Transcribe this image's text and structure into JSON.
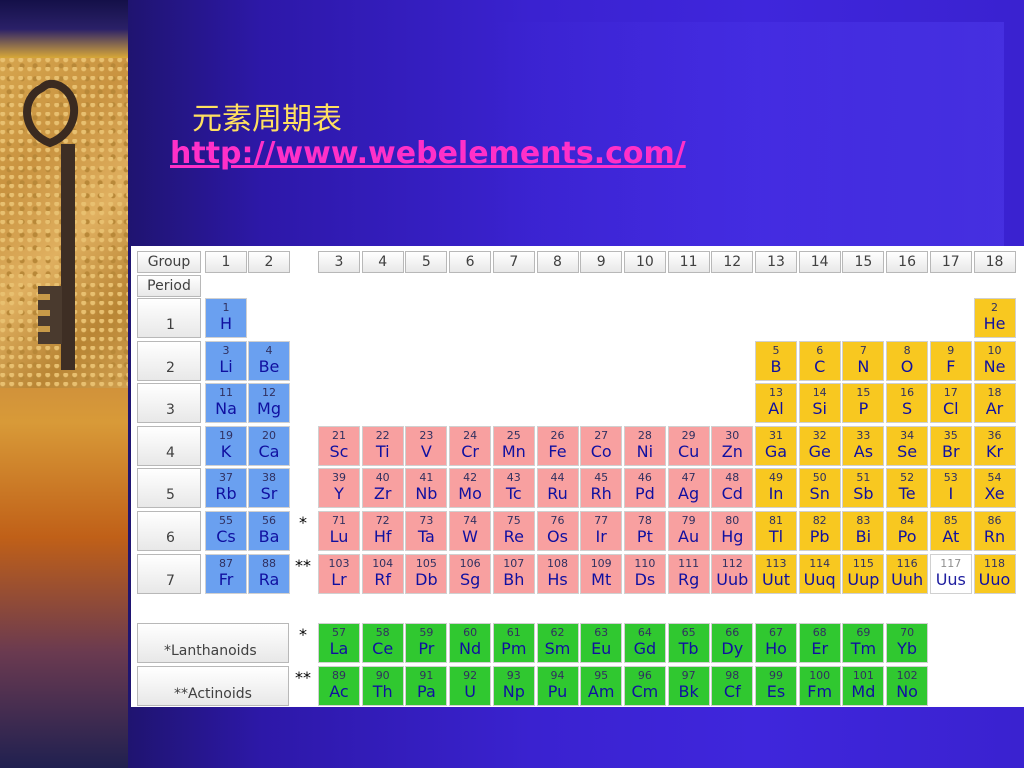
{
  "slide": {
    "title": "元素周期表",
    "link": "http://www.webelements.com/"
  },
  "table": {
    "group_label": "Group",
    "period_label": "Period",
    "groups": [
      "1",
      "2",
      "3",
      "4",
      "5",
      "6",
      "7",
      "8",
      "9",
      "10",
      "11",
      "12",
      "13",
      "14",
      "15",
      "16",
      "17",
      "18"
    ],
    "periods": [
      "1",
      "2",
      "3",
      "4",
      "5",
      "6",
      "7"
    ],
    "lanthanoids_label": "*Lanthanoids",
    "actinoids_label": "**Actinoids",
    "lanthanoid_marker": "*",
    "actinoid_marker": "**",
    "elements": [
      {
        "n": "1",
        "s": "H",
        "g": 1,
        "p": 1,
        "b": "s"
      },
      {
        "n": "2",
        "s": "He",
        "g": 18,
        "p": 1,
        "b": "p"
      },
      {
        "n": "3",
        "s": "Li",
        "g": 1,
        "p": 2,
        "b": "s"
      },
      {
        "n": "4",
        "s": "Be",
        "g": 2,
        "p": 2,
        "b": "s"
      },
      {
        "n": "5",
        "s": "B",
        "g": 13,
        "p": 2,
        "b": "p"
      },
      {
        "n": "6",
        "s": "C",
        "g": 14,
        "p": 2,
        "b": "p"
      },
      {
        "n": "7",
        "s": "N",
        "g": 15,
        "p": 2,
        "b": "p"
      },
      {
        "n": "8",
        "s": "O",
        "g": 16,
        "p": 2,
        "b": "p"
      },
      {
        "n": "9",
        "s": "F",
        "g": 17,
        "p": 2,
        "b": "p"
      },
      {
        "n": "10",
        "s": "Ne",
        "g": 18,
        "p": 2,
        "b": "p"
      },
      {
        "n": "11",
        "s": "Na",
        "g": 1,
        "p": 3,
        "b": "s"
      },
      {
        "n": "12",
        "s": "Mg",
        "g": 2,
        "p": 3,
        "b": "s"
      },
      {
        "n": "13",
        "s": "Al",
        "g": 13,
        "p": 3,
        "b": "p"
      },
      {
        "n": "14",
        "s": "Si",
        "g": 14,
        "p": 3,
        "b": "p"
      },
      {
        "n": "15",
        "s": "P",
        "g": 15,
        "p": 3,
        "b": "p"
      },
      {
        "n": "16",
        "s": "S",
        "g": 16,
        "p": 3,
        "b": "p"
      },
      {
        "n": "17",
        "s": "Cl",
        "g": 17,
        "p": 3,
        "b": "p"
      },
      {
        "n": "18",
        "s": "Ar",
        "g": 18,
        "p": 3,
        "b": "p"
      },
      {
        "n": "19",
        "s": "K",
        "g": 1,
        "p": 4,
        "b": "s"
      },
      {
        "n": "20",
        "s": "Ca",
        "g": 2,
        "p": 4,
        "b": "s"
      },
      {
        "n": "21",
        "s": "Sc",
        "g": 3,
        "p": 4,
        "b": "d"
      },
      {
        "n": "22",
        "s": "Ti",
        "g": 4,
        "p": 4,
        "b": "d"
      },
      {
        "n": "23",
        "s": "V",
        "g": 5,
        "p": 4,
        "b": "d"
      },
      {
        "n": "24",
        "s": "Cr",
        "g": 6,
        "p": 4,
        "b": "d"
      },
      {
        "n": "25",
        "s": "Mn",
        "g": 7,
        "p": 4,
        "b": "d"
      },
      {
        "n": "26",
        "s": "Fe",
        "g": 8,
        "p": 4,
        "b": "d"
      },
      {
        "n": "27",
        "s": "Co",
        "g": 9,
        "p": 4,
        "b": "d"
      },
      {
        "n": "28",
        "s": "Ni",
        "g": 10,
        "p": 4,
        "b": "d"
      },
      {
        "n": "29",
        "s": "Cu",
        "g": 11,
        "p": 4,
        "b": "d"
      },
      {
        "n": "30",
        "s": "Zn",
        "g": 12,
        "p": 4,
        "b": "d"
      },
      {
        "n": "31",
        "s": "Ga",
        "g": 13,
        "p": 4,
        "b": "p"
      },
      {
        "n": "32",
        "s": "Ge",
        "g": 14,
        "p": 4,
        "b": "p"
      },
      {
        "n": "33",
        "s": "As",
        "g": 15,
        "p": 4,
        "b": "p"
      },
      {
        "n": "34",
        "s": "Se",
        "g": 16,
        "p": 4,
        "b": "p"
      },
      {
        "n": "35",
        "s": "Br",
        "g": 17,
        "p": 4,
        "b": "p"
      },
      {
        "n": "36",
        "s": "Kr",
        "g": 18,
        "p": 4,
        "b": "p"
      },
      {
        "n": "37",
        "s": "Rb",
        "g": 1,
        "p": 5,
        "b": "s"
      },
      {
        "n": "38",
        "s": "Sr",
        "g": 2,
        "p": 5,
        "b": "s"
      },
      {
        "n": "39",
        "s": "Y",
        "g": 3,
        "p": 5,
        "b": "d"
      },
      {
        "n": "40",
        "s": "Zr",
        "g": 4,
        "p": 5,
        "b": "d"
      },
      {
        "n": "41",
        "s": "Nb",
        "g": 5,
        "p": 5,
        "b": "d"
      },
      {
        "n": "42",
        "s": "Mo",
        "g": 6,
        "p": 5,
        "b": "d"
      },
      {
        "n": "43",
        "s": "Tc",
        "g": 7,
        "p": 5,
        "b": "d"
      },
      {
        "n": "44",
        "s": "Ru",
        "g": 8,
        "p": 5,
        "b": "d"
      },
      {
        "n": "45",
        "s": "Rh",
        "g": 9,
        "p": 5,
        "b": "d"
      },
      {
        "n": "46",
        "s": "Pd",
        "g": 10,
        "p": 5,
        "b": "d"
      },
      {
        "n": "47",
        "s": "Ag",
        "g": 11,
        "p": 5,
        "b": "d"
      },
      {
        "n": "48",
        "s": "Cd",
        "g": 12,
        "p": 5,
        "b": "d"
      },
      {
        "n": "49",
        "s": "In",
        "g": 13,
        "p": 5,
        "b": "p"
      },
      {
        "n": "50",
        "s": "Sn",
        "g": 14,
        "p": 5,
        "b": "p"
      },
      {
        "n": "51",
        "s": "Sb",
        "g": 15,
        "p": 5,
        "b": "p"
      },
      {
        "n": "52",
        "s": "Te",
        "g": 16,
        "p": 5,
        "b": "p"
      },
      {
        "n": "53",
        "s": "I",
        "g": 17,
        "p": 5,
        "b": "p"
      },
      {
        "n": "54",
        "s": "Xe",
        "g": 18,
        "p": 5,
        "b": "p"
      },
      {
        "n": "55",
        "s": "Cs",
        "g": 1,
        "p": 6,
        "b": "s"
      },
      {
        "n": "56",
        "s": "Ba",
        "g": 2,
        "p": 6,
        "b": "s"
      },
      {
        "n": "71",
        "s": "Lu",
        "g": 3,
        "p": 6,
        "b": "d"
      },
      {
        "n": "72",
        "s": "Hf",
        "g": 4,
        "p": 6,
        "b": "d"
      },
      {
        "n": "73",
        "s": "Ta",
        "g": 5,
        "p": 6,
        "b": "d"
      },
      {
        "n": "74",
        "s": "W",
        "g": 6,
        "p": 6,
        "b": "d"
      },
      {
        "n": "75",
        "s": "Re",
        "g": 7,
        "p": 6,
        "b": "d"
      },
      {
        "n": "76",
        "s": "Os",
        "g": 8,
        "p": 6,
        "b": "d"
      },
      {
        "n": "77",
        "s": "Ir",
        "g": 9,
        "p": 6,
        "b": "d"
      },
      {
        "n": "78",
        "s": "Pt",
        "g": 10,
        "p": 6,
        "b": "d"
      },
      {
        "n": "79",
        "s": "Au",
        "g": 11,
        "p": 6,
        "b": "d"
      },
      {
        "n": "80",
        "s": "Hg",
        "g": 12,
        "p": 6,
        "b": "d"
      },
      {
        "n": "81",
        "s": "Tl",
        "g": 13,
        "p": 6,
        "b": "p"
      },
      {
        "n": "82",
        "s": "Pb",
        "g": 14,
        "p": 6,
        "b": "p"
      },
      {
        "n": "83",
        "s": "Bi",
        "g": 15,
        "p": 6,
        "b": "p"
      },
      {
        "n": "84",
        "s": "Po",
        "g": 16,
        "p": 6,
        "b": "p"
      },
      {
        "n": "85",
        "s": "At",
        "g": 17,
        "p": 6,
        "b": "p"
      },
      {
        "n": "86",
        "s": "Rn",
        "g": 18,
        "p": 6,
        "b": "p"
      },
      {
        "n": "87",
        "s": "Fr",
        "g": 1,
        "p": 7,
        "b": "s"
      },
      {
        "n": "88",
        "s": "Ra",
        "g": 2,
        "p": 7,
        "b": "s"
      },
      {
        "n": "103",
        "s": "Lr",
        "g": 3,
        "p": 7,
        "b": "d"
      },
      {
        "n": "104",
        "s": "Rf",
        "g": 4,
        "p": 7,
        "b": "d"
      },
      {
        "n": "105",
        "s": "Db",
        "g": 5,
        "p": 7,
        "b": "d"
      },
      {
        "n": "106",
        "s": "Sg",
        "g": 6,
        "p": 7,
        "b": "d"
      },
      {
        "n": "107",
        "s": "Bh",
        "g": 7,
        "p": 7,
        "b": "d"
      },
      {
        "n": "108",
        "s": "Hs",
        "g": 8,
        "p": 7,
        "b": "d"
      },
      {
        "n": "109",
        "s": "Mt",
        "g": 9,
        "p": 7,
        "b": "d"
      },
      {
        "n": "110",
        "s": "Ds",
        "g": 10,
        "p": 7,
        "b": "d"
      },
      {
        "n": "111",
        "s": "Rg",
        "g": 11,
        "p": 7,
        "b": "d"
      },
      {
        "n": "112",
        "s": "Uub",
        "g": 12,
        "p": 7,
        "b": "d"
      },
      {
        "n": "113",
        "s": "Uut",
        "g": 13,
        "p": 7,
        "b": "p"
      },
      {
        "n": "114",
        "s": "Uuq",
        "g": 14,
        "p": 7,
        "b": "p"
      },
      {
        "n": "115",
        "s": "Uup",
        "g": 15,
        "p": 7,
        "b": "p"
      },
      {
        "n": "116",
        "s": "Uuh",
        "g": 16,
        "p": 7,
        "b": "p"
      },
      {
        "n": "117",
        "s": "Uus",
        "g": 17,
        "p": 7,
        "b": "ps"
      },
      {
        "n": "118",
        "s": "Uuo",
        "g": 18,
        "p": 7,
        "b": "p"
      }
    ],
    "lanthanoids": [
      {
        "n": "57",
        "s": "La"
      },
      {
        "n": "58",
        "s": "Ce"
      },
      {
        "n": "59",
        "s": "Pr"
      },
      {
        "n": "60",
        "s": "Nd"
      },
      {
        "n": "61",
        "s": "Pm"
      },
      {
        "n": "62",
        "s": "Sm"
      },
      {
        "n": "63",
        "s": "Eu"
      },
      {
        "n": "64",
        "s": "Gd"
      },
      {
        "n": "65",
        "s": "Tb"
      },
      {
        "n": "66",
        "s": "Dy"
      },
      {
        "n": "67",
        "s": "Ho"
      },
      {
        "n": "68",
        "s": "Er"
      },
      {
        "n": "69",
        "s": "Tm"
      },
      {
        "n": "70",
        "s": "Yb"
      }
    ],
    "actinoids": [
      {
        "n": "89",
        "s": "Ac"
      },
      {
        "n": "90",
        "s": "Th"
      },
      {
        "n": "91",
        "s": "Pa"
      },
      {
        "n": "92",
        "s": "U"
      },
      {
        "n": "93",
        "s": "Np"
      },
      {
        "n": "94",
        "s": "Pu"
      },
      {
        "n": "95",
        "s": "Am"
      },
      {
        "n": "96",
        "s": "Cm"
      },
      {
        "n": "97",
        "s": "Bk"
      },
      {
        "n": "98",
        "s": "Cf"
      },
      {
        "n": "99",
        "s": "Es"
      },
      {
        "n": "100",
        "s": "Fm"
      },
      {
        "n": "101",
        "s": "Md"
      },
      {
        "n": "102",
        "s": "No"
      }
    ]
  },
  "colors": {
    "s_block": "#6aa0f0",
    "d_block": "#f8a0a0",
    "p_block": "#f8c820",
    "f_block": "#30c830",
    "title_color": "#ffe060",
    "link_color": "#ff30c8"
  }
}
